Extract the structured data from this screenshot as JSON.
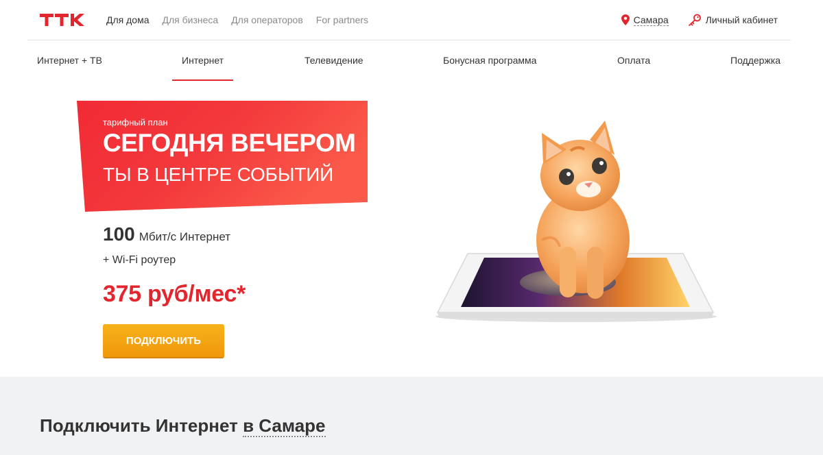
{
  "header": {
    "logo_text": "ТТК",
    "segments": [
      {
        "label": "Для дома",
        "active": true
      },
      {
        "label": "Для бизнеса",
        "active": false
      },
      {
        "label": "Для операторов",
        "active": false
      },
      {
        "label": "For partners",
        "active": false
      }
    ],
    "city_label": "Самара",
    "city_icon": "location-pin-icon",
    "cabinet_label": "Личный кабинет",
    "cabinet_icon": "key-icon"
  },
  "nav": {
    "items": [
      {
        "label": "Интернет + ТВ",
        "active": false
      },
      {
        "label": "Интернет",
        "active": true
      },
      {
        "label": "Телевидение",
        "active": false
      },
      {
        "label": "Бонусная программа",
        "active": false
      },
      {
        "label": "Оплата",
        "active": false
      },
      {
        "label": "Поддержка",
        "active": false
      }
    ]
  },
  "hero": {
    "plan_small": "тарифный план",
    "plan_title": "СЕГОДНЯ ВЕЧЕРОМ",
    "plan_subtitle": "ТЫ В ЦЕНТРЕ СОБЫТИЙ",
    "speed_value": "100",
    "speed_text": "Мбит/с Интернет",
    "wifi_text": "+ Wi-Fi роутер",
    "price": "375 руб/мес*",
    "button_label": "ПОДКЛЮЧИТЬ",
    "illustration": "kitten-on-tablet"
  },
  "bottom": {
    "title_prefix": "Подключить Интернет ",
    "title_city": "в Самаре"
  },
  "colors": {
    "brand_red": "#e3262e",
    "button_orange": "#f5a412",
    "gray_bg": "#f1f2f4"
  }
}
